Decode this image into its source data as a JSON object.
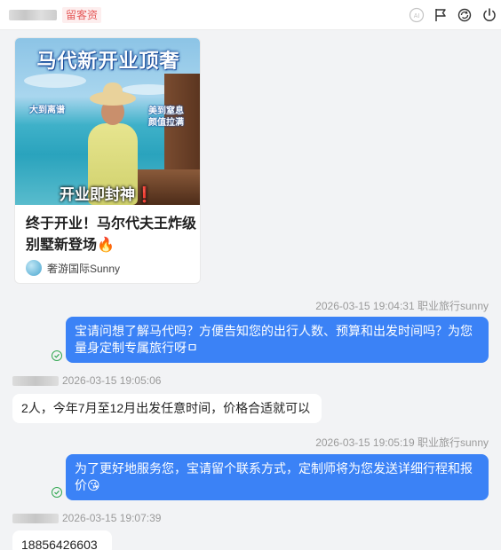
{
  "header": {
    "tag": "留客资",
    "icons": [
      "ai-icon",
      "flag-icon",
      "transfer-icon",
      "power-icon"
    ]
  },
  "article": {
    "cover_headline": "马代新开业顶奢",
    "cover_left_text": "大到离谱",
    "cover_right_text_1": "美到窒息",
    "cover_right_text_2": "颜值拉满",
    "cover_bottom_text": "开业即封神",
    "cover_bottom_mark": "❗",
    "title": "终于开业！马尔代夫王炸级别墅新登场🔥",
    "author": "奢游国际Sunny"
  },
  "messages": [
    {
      "direction": "out",
      "timestamp": "2026-03-15 19:04:31 职业旅行sunny",
      "text": "宝请问想了解马代吗？方便告知您的出行人数、预算和出发时间吗？为您量身定制专属旅行呀ㅁ"
    },
    {
      "direction": "in",
      "timestamp": "2026-03-15 19:05:06",
      "text": "2人，今年7月至12月出发任意时间，价格合适就可以"
    },
    {
      "direction": "out",
      "timestamp": "2026-03-15 19:05:19 职业旅行sunny",
      "text": "为了更好地服务您，宝请留个联系方式，定制师将为您发送详细行程和报价😘"
    },
    {
      "direction": "in",
      "timestamp": "2026-03-15 19:07:39",
      "text": "18856426603"
    }
  ],
  "colors": {
    "outgoing_bubble": "#3b82f6",
    "tag_text": "#e55a5a",
    "read_check": "#34a853"
  }
}
